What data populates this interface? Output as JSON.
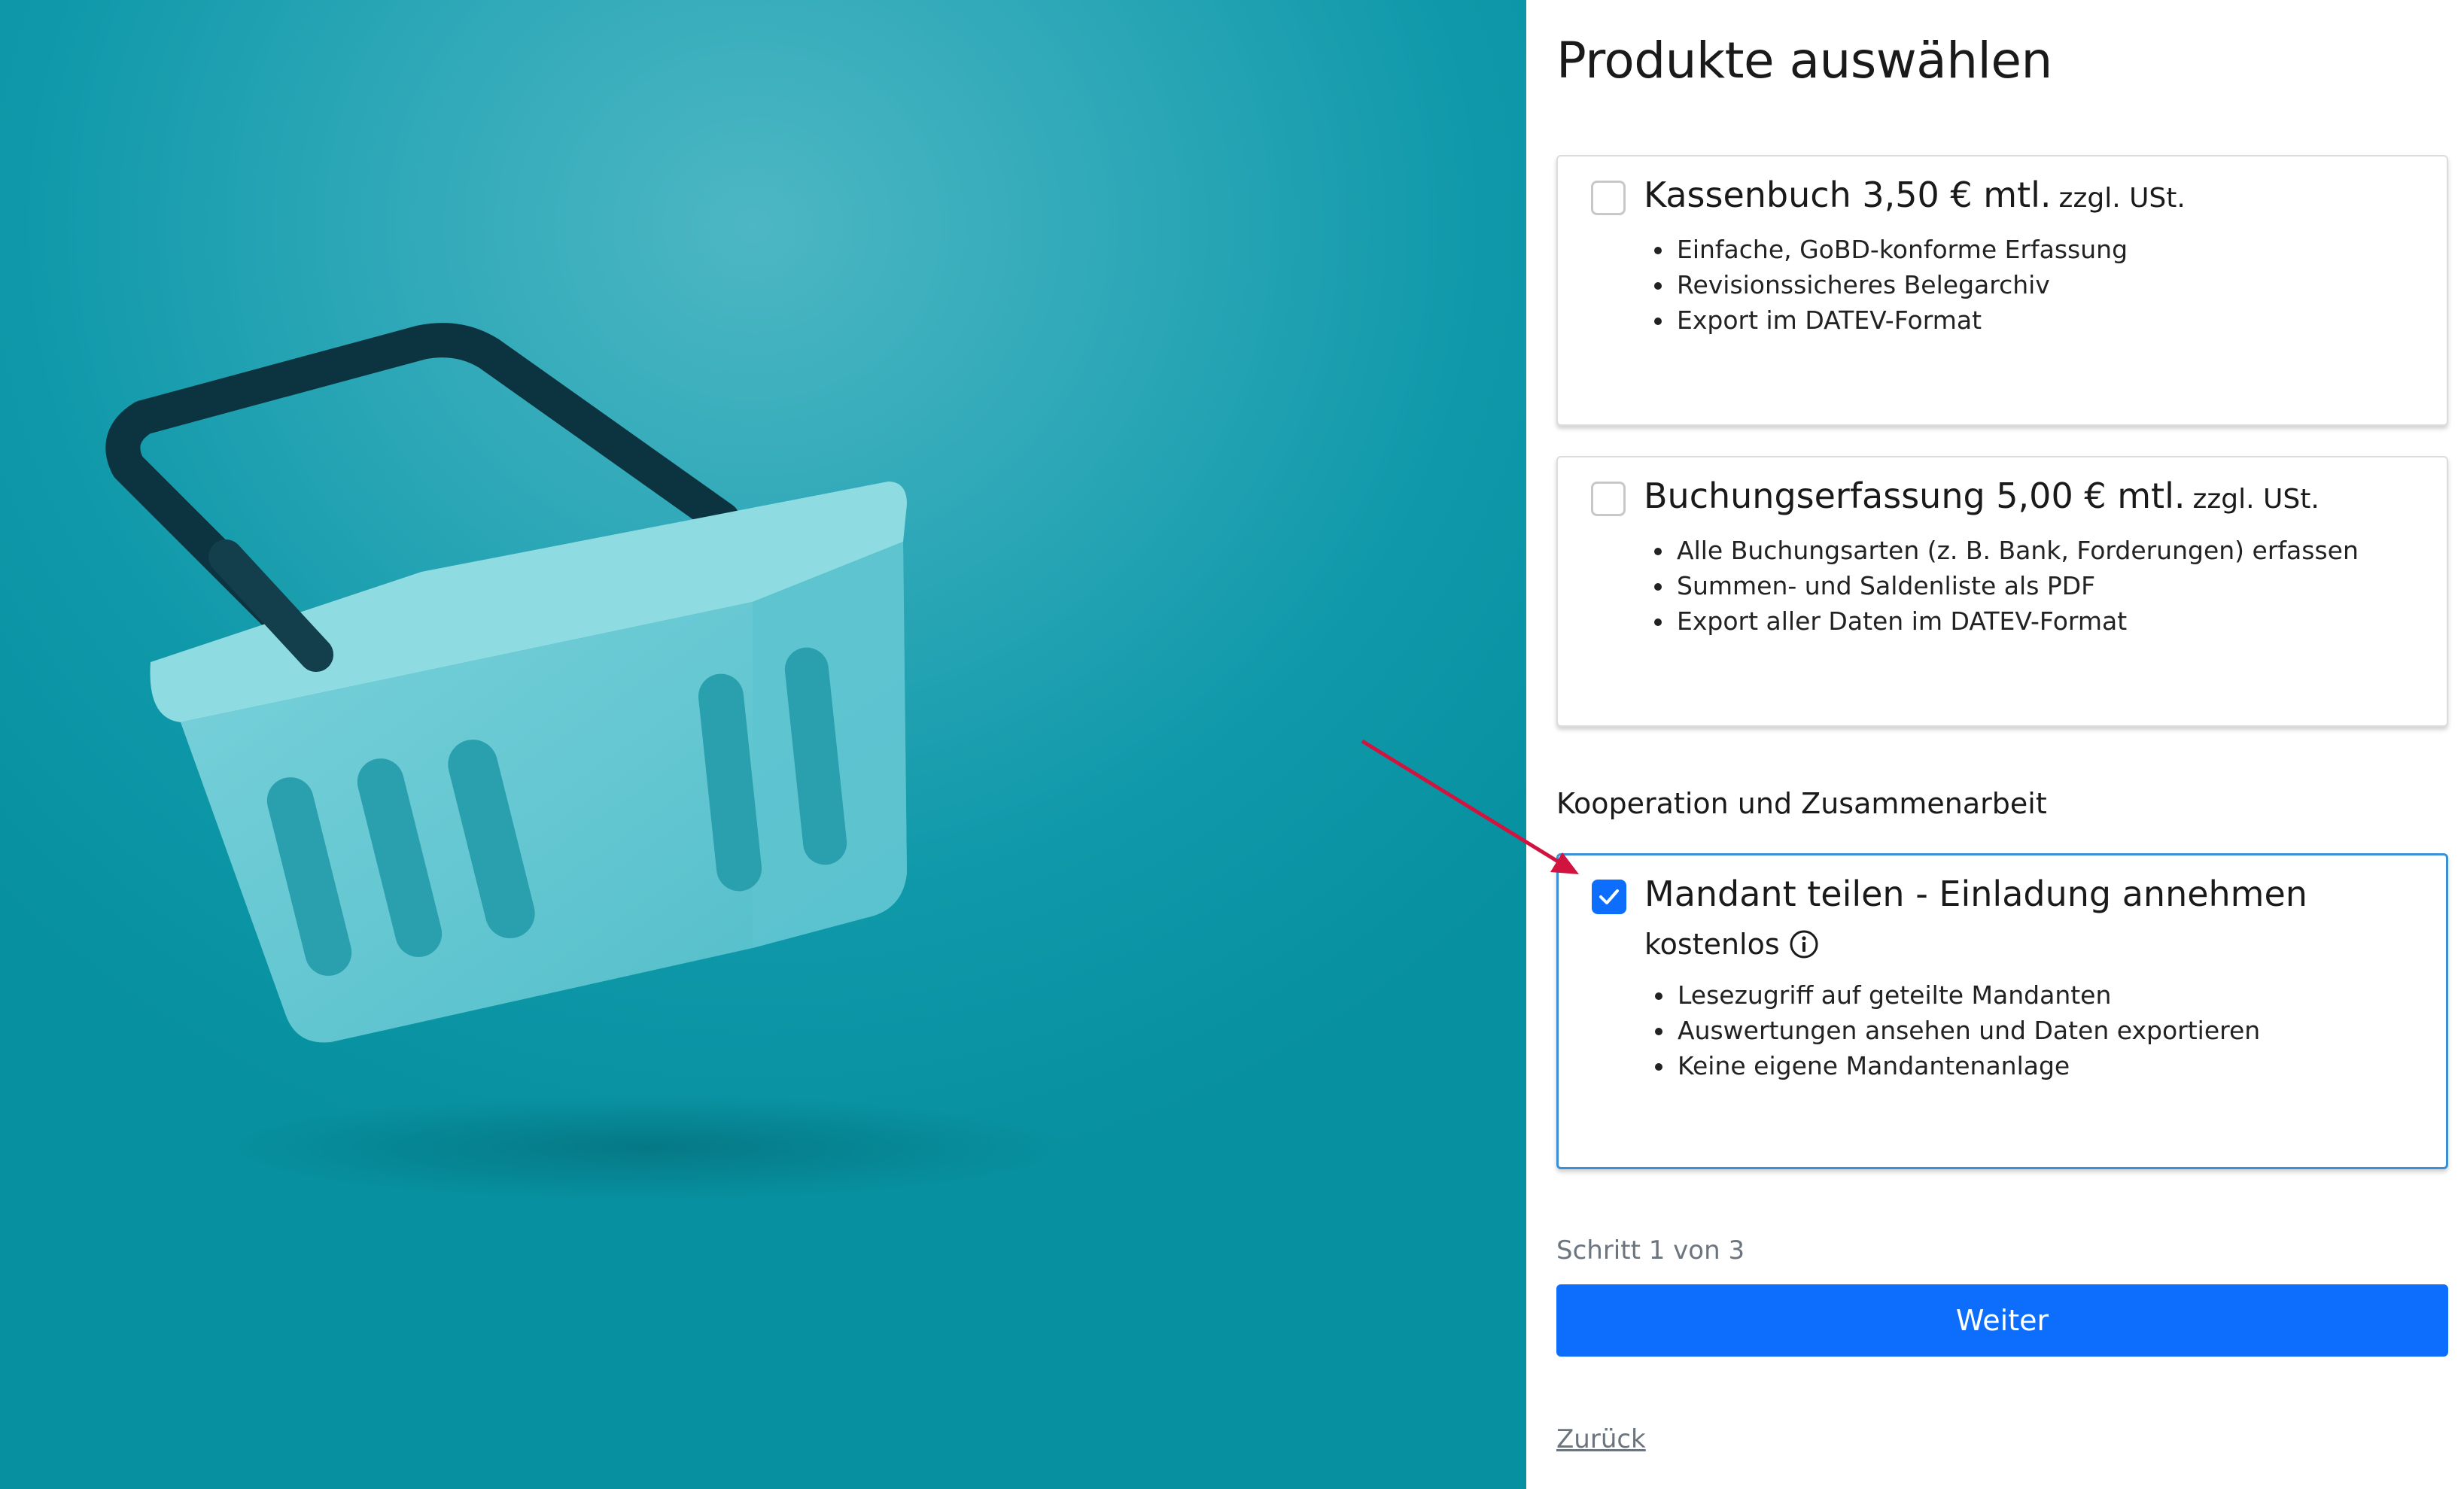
{
  "page": {
    "title": "Produkte auswählen"
  },
  "products": [
    {
      "name": "Kassenbuch 3,50 € mtl.",
      "suffix": "zzgl. USt.",
      "checked": false,
      "features": [
        "Einfache, GoBD-konforme Erfassung",
        "Revisionssicheres Belegarchiv",
        "Export im DATEV-Format"
      ]
    },
    {
      "name": "Buchungserfassung 5,00 € mtl.",
      "suffix": "zzgl. USt.",
      "checked": false,
      "features": [
        "Alle Buchungsarten (z. B. Bank, Forderungen) erfassen",
        "Summen- und Saldenliste als PDF",
        "Export aller Daten im DATEV-Format"
      ]
    }
  ],
  "cooperation": {
    "section_label": "Kooperation und Zusammenarbeit",
    "name": "Mandant teilen - Einladung annehmen",
    "price": "kostenlos",
    "info_icon": "info-circle-icon",
    "checked": true,
    "features": [
      "Lesezugriff auf geteilte Mandanten",
      "Auswertungen ansehen und Daten exportieren",
      "Keine eigene Mandantenanlage"
    ]
  },
  "footer": {
    "step": "Schritt 1 von 3",
    "next_label": "Weiter",
    "back_label": "Zurück"
  },
  "colors": {
    "primary": "#0d6efd",
    "hero": "#0e98a9",
    "annotation_arrow": "#d1143f"
  }
}
